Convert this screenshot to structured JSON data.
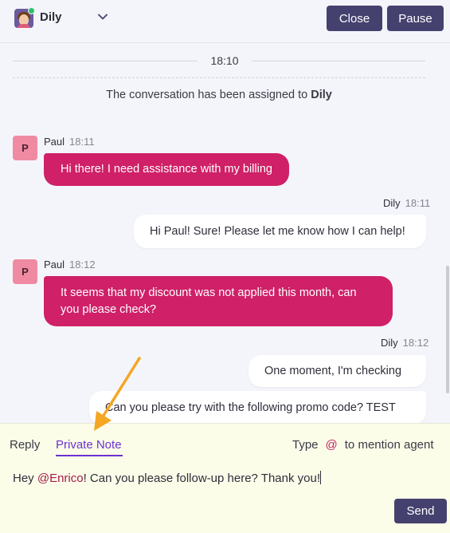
{
  "header": {
    "agent_name": "Dily",
    "agent_status": "online",
    "close_label": "Close",
    "pause_label": "Pause"
  },
  "conversation": {
    "time_divider": "18:10",
    "system_message": {
      "text": "The conversation has been assigned to",
      "assignee": "Dily"
    },
    "messages": [
      {
        "direction": "incoming",
        "sender": "Paul",
        "avatar_initial": "P",
        "time": "18:11",
        "text": "Hi there! I need assistance with my billing"
      },
      {
        "direction": "outgoing",
        "sender": "Dily",
        "time": "18:11",
        "text": "Hi Paul! Sure! Please let me know how I can help!"
      },
      {
        "direction": "incoming",
        "sender": "Paul",
        "avatar_initial": "P",
        "time": "18:12",
        "text_lines": [
          "It seems that my discount was not applied this month, can",
          "you please check?"
        ]
      },
      {
        "direction": "outgoing",
        "sender": "Dily",
        "time": "18:12",
        "text": "One moment, I'm checking"
      },
      {
        "direction": "outgoing",
        "text": "Can you please try with the following promo code? TEST"
      }
    ]
  },
  "composer": {
    "tabs": [
      {
        "label": "Reply",
        "active": false
      },
      {
        "label": "Private Note",
        "active": true
      }
    ],
    "mention_hint": {
      "prefix": "Type",
      "symbol": "@",
      "suffix": "to mention agent"
    },
    "input": {
      "before_mention": "Hey ",
      "mention": "@Enrico",
      "after_mention": "! Can you please follow-up here? Thank you!"
    },
    "send_label": "Send"
  },
  "colors": {
    "incoming_bubble": "#cf2068",
    "button": "#45416f",
    "active_tab": "#6b32d3",
    "composer_bg": "#fcfde9",
    "annotation_arrow": "#f5a623"
  }
}
